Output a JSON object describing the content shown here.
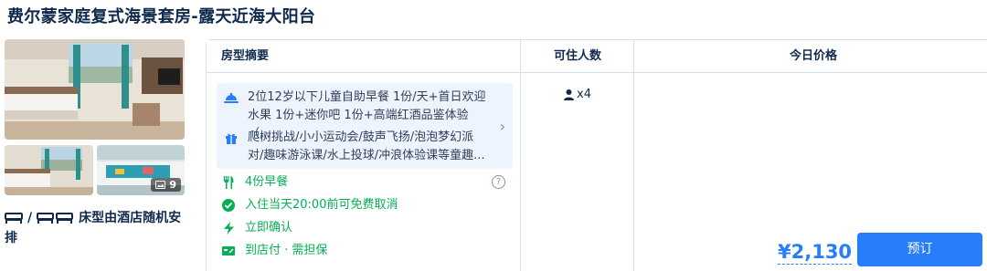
{
  "room": {
    "title": "费尔蒙家庭复式海景套房-露天近海大阳台",
    "photo_count": "9",
    "bed_separator": "/",
    "bed_text": "床型由酒店随机安排"
  },
  "table": {
    "headers": {
      "summary": "房型摘要",
      "occupancy": "可住人数",
      "price": "今日价格"
    }
  },
  "offer": {
    "benefits": [
      {
        "icon": "dining-dome-icon",
        "text": "2位12岁以下儿童自助早餐 1份/天+首日欢迎水果 1份+迷你吧 1份+高端红酒品鉴体验（..."
      },
      {
        "icon": "gift-icon",
        "text": "爬树挑战/小小运动会/鼓声飞扬/泡泡梦幻派对/趣味游泳课/水上投球/冲浪体验课等童趣..."
      }
    ],
    "policies": [
      {
        "icon": "fork-knife-icon",
        "text": "4份早餐"
      },
      {
        "icon": "check-circle-icon",
        "text": "入住当天20:00前可免费取消"
      },
      {
        "icon": "lightning-icon",
        "text": "立即确认"
      },
      {
        "icon": "pay-at-hotel-icon",
        "text": "到店付 · 需担保"
      }
    ],
    "help_icon": "?",
    "occupancy": "x4",
    "price": "¥2,130",
    "book_label": "预订"
  },
  "colors": {
    "brand_blue": "#287dfa",
    "success_green": "#06ae58",
    "text_dark": "#0f294d",
    "benefit_bg": "#eef4fe"
  }
}
